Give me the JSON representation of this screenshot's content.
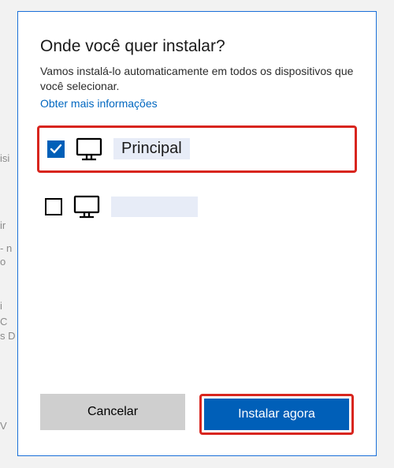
{
  "title": "Onde você quer instalar?",
  "description": "Vamos instalá-lo automaticamente em todos os dispositivos que você selecionar.",
  "more_info": "Obter mais informações",
  "devices": [
    {
      "label": "Principal",
      "checked": true,
      "highlighted": true
    },
    {
      "label": "",
      "checked": false,
      "highlighted": false
    }
  ],
  "buttons": {
    "cancel": "Cancelar",
    "install": "Instalar agora"
  },
  "bg_fragments": [
    "isi",
    "ir",
    "- n",
    "o",
    "i",
    "C",
    "s D",
    "V"
  ]
}
